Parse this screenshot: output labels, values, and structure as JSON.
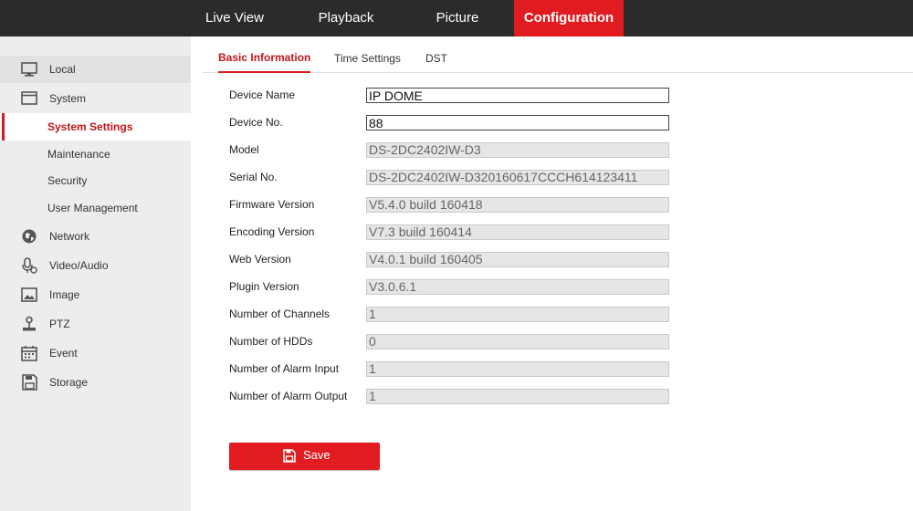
{
  "top_nav": {
    "live_view": "Live View",
    "playback": "Playback",
    "picture": "Picture",
    "configuration": "Configuration"
  },
  "sidebar": {
    "local": "Local",
    "system": "System",
    "system_settings": "System Settings",
    "maintenance": "Maintenance",
    "security": "Security",
    "user_management": "User Management",
    "network": "Network",
    "video_audio": "Video/Audio",
    "image": "Image",
    "ptz": "PTZ",
    "event": "Event",
    "storage": "Storage"
  },
  "tabs": {
    "basic_information": "Basic Information",
    "time_settings": "Time Settings",
    "dst": "DST"
  },
  "fields": [
    {
      "label": "Device Name",
      "value": "IP DOME"
    },
    {
      "label": "Device No.",
      "value": "88"
    },
    {
      "label": "Model",
      "value": "DS-2DC2402IW-D3"
    },
    {
      "label": "Serial No.",
      "value": "DS-2DC2402IW-D320160617CCCH614123411"
    },
    {
      "label": "Firmware Version",
      "value": "V5.4.0 build 160418"
    },
    {
      "label": "Encoding Version",
      "value": "V7.3 build 160414"
    },
    {
      "label": "Web Version",
      "value": "V4.0.1 build 160405"
    },
    {
      "label": "Plugin Version",
      "value": "V3.0.6.1"
    },
    {
      "label": "Number of Channels",
      "value": "1"
    },
    {
      "label": "Number of HDDs",
      "value": "0"
    },
    {
      "label": "Number of Alarm Input",
      "value": "1"
    },
    {
      "label": "Number of Alarm Output",
      "value": "1"
    }
  ],
  "save_button": {
    "label": "Save"
  },
  "colors": {
    "accent": "#e01c21",
    "topbar": "#2b2b2b",
    "sidebar": "#ededed"
  },
  "icons": [
    "monitor-icon",
    "system-window-icon",
    "globe-icon",
    "microphone-icon",
    "image-icon",
    "ptz-joystick-icon",
    "calendar-icon",
    "floppy-disk-icon"
  ]
}
